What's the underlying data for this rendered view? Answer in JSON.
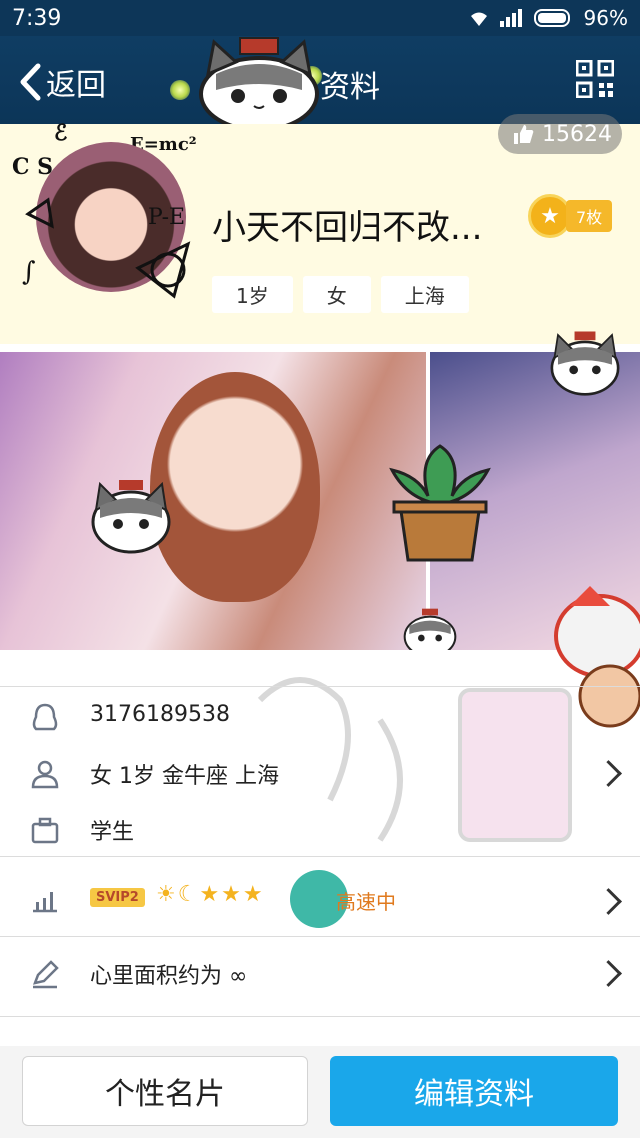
{
  "status_bar": {
    "time": "7:39",
    "battery": "96%"
  },
  "nav": {
    "back_label": "返回",
    "title": "资料"
  },
  "header": {
    "likes": "15624",
    "nickname": "小天不回归不改...",
    "medal_count": "7枚",
    "tags": [
      "1岁",
      "女",
      "上海"
    ]
  },
  "info": {
    "qq_number": "3176189538",
    "profile_summary": "女  1岁  金牛座  上海",
    "occupation": "学生",
    "svip": "SVIP2",
    "speed_text": "高速中",
    "signature": "心里面积约为 ∞"
  },
  "bottom": {
    "card_button": "个性名片",
    "edit_button": "编辑资料"
  },
  "colors": {
    "nav": "#0d3658",
    "accent": "#1aa7ea",
    "header_bg": "#fffbe2"
  }
}
